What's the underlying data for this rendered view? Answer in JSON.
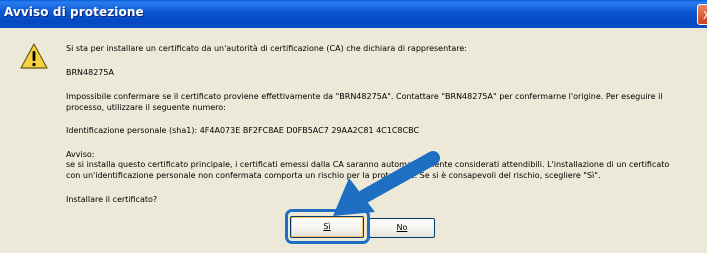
{
  "dialog": {
    "title": "Avviso di protezione",
    "close_glyph": "X",
    "icon": "warning-icon",
    "lines": {
      "intro": "Si sta per installare un certificato da un'autorità di certificazione (CA) che dichiara di rappresentare:",
      "ca_name": "BRN48275A",
      "confirm_1": "Impossibile confermare se il certificato proviene effettivamente da \"BRN48275A\". Contattare \"BRN48275A\" per confermarne l'origine. Per eseguire il",
      "confirm_2": "processo, utilizzare il seguente numero:",
      "thumbprint": "Identificazione personale (sha1): 4F4A073E BF2FC8AE D0FB5AC7 29AA2C81 4C1C8CBC",
      "warning_heading": "Avviso:",
      "warning_1": "se si installa questo certificato principale, i certificati emessi dalla CA saranno automaticamente considerati attendibili. L'installazione di un certificato",
      "warning_2": "con un'identificazione personale non confermata comporta un rischio per la protezione. Se si è consapevoli del rischio, scegliere \"Sì\".",
      "question": "Installare il certificato?"
    },
    "buttons": {
      "yes": "Sì",
      "no": "No"
    },
    "colors": {
      "titlebar": "#0a56d0",
      "face": "#ece9d8",
      "highlight": "#1e6fc3",
      "arrow": "#1e6fc3"
    }
  }
}
